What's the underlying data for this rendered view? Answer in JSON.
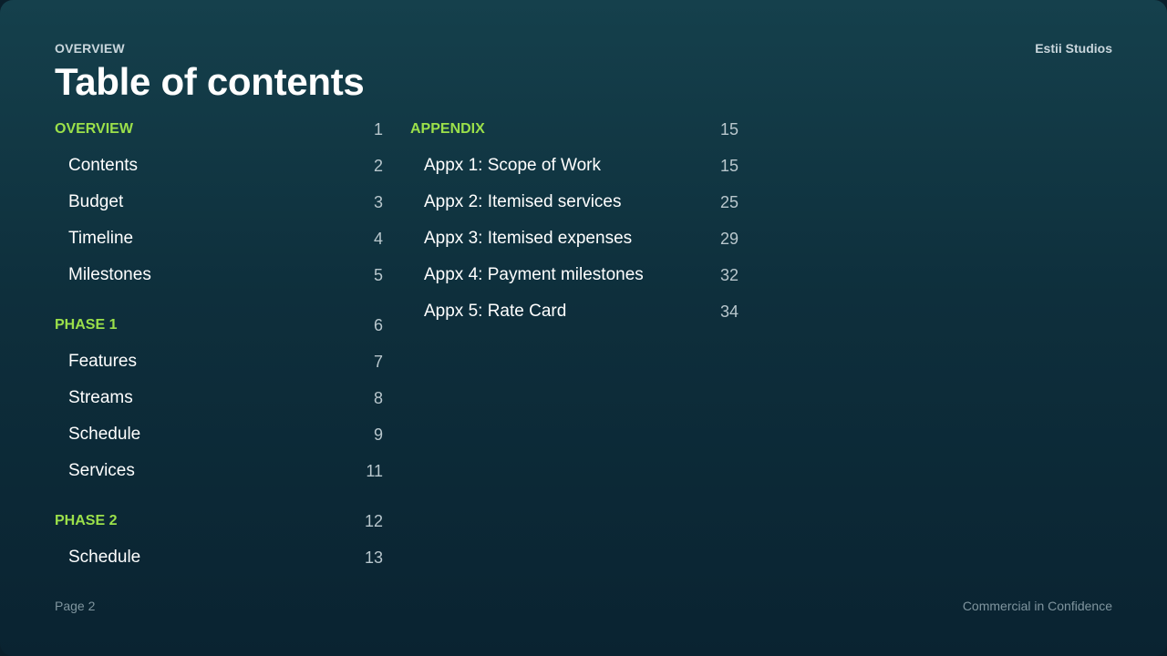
{
  "header": {
    "eyebrow": "OVERVIEW",
    "title": "Table of contents",
    "brand": "Estii Studios"
  },
  "toc": {
    "left": [
      {
        "heading": {
          "label": "OVERVIEW",
          "page": "1"
        },
        "items": [
          {
            "label": "Contents",
            "page": "2"
          },
          {
            "label": "Budget",
            "page": "3"
          },
          {
            "label": "Timeline",
            "page": "4"
          },
          {
            "label": "Milestones",
            "page": "5"
          }
        ]
      },
      {
        "heading": {
          "label": "PHASE 1",
          "page": "6"
        },
        "items": [
          {
            "label": "Features",
            "page": "7"
          },
          {
            "label": "Streams",
            "page": "8"
          },
          {
            "label": "Schedule",
            "page": "9"
          },
          {
            "label": "Services",
            "page": "11"
          }
        ]
      },
      {
        "heading": {
          "label": "PHASE 2",
          "page": "12"
        },
        "items": [
          {
            "label": "Schedule",
            "page": "13"
          }
        ]
      }
    ],
    "right": [
      {
        "heading": {
          "label": "APPENDIX",
          "page": "15"
        },
        "items": [
          {
            "label": "Appx 1: Scope of Work",
            "page": "15"
          },
          {
            "label": "Appx 2: Itemised services",
            "page": "25"
          },
          {
            "label": "Appx 3: Itemised expenses",
            "page": "29"
          },
          {
            "label": "Appx 4: Payment milestones",
            "page": "32"
          },
          {
            "label": "Appx 5: Rate Card",
            "page": "34"
          }
        ]
      }
    ]
  },
  "footer": {
    "page_label": "Page 2",
    "confidentiality": "Commercial in Confidence"
  },
  "colors": {
    "accent": "#9be04a",
    "background_top": "#15404c",
    "background_bottom": "#0a2331"
  }
}
